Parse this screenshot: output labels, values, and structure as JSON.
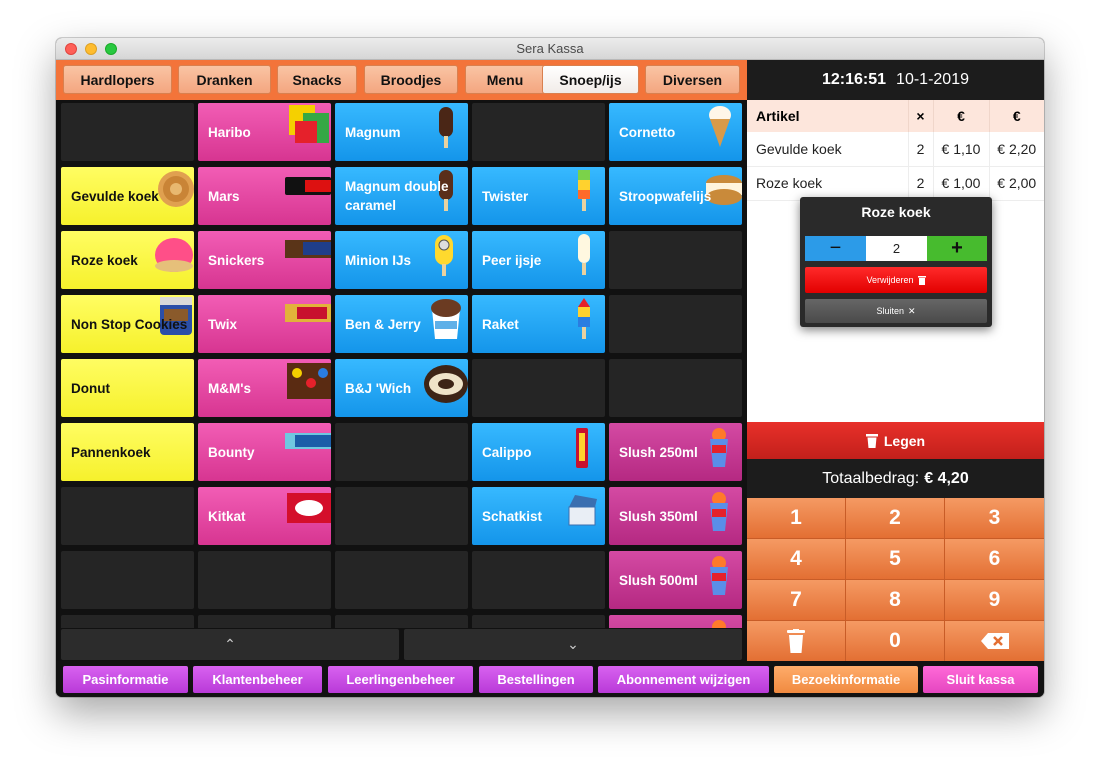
{
  "window": {
    "title": "Sera Kassa"
  },
  "categories": [
    {
      "label": "Hardlopers",
      "active": false
    },
    {
      "label": "Dranken",
      "active": false
    },
    {
      "label": "Snacks",
      "active": false
    },
    {
      "label": "Broodjes",
      "active": false
    },
    {
      "label": "Menu",
      "active": false
    },
    {
      "label": "Snoep/ijs",
      "active": true
    },
    {
      "label": "Diversen",
      "active": false
    }
  ],
  "products": {
    "gevulde_koek": "Gevulde koek",
    "roze_koek": "Roze koek",
    "non_stop_cookies": "Non Stop Cookies",
    "donut": "Donut",
    "pannenkoek": "Pannenkoek",
    "haribo": "Haribo",
    "mars": "Mars",
    "snickers": "Snickers",
    "twix": "Twix",
    "mms": "M&M's",
    "bounty": "Bounty",
    "kitkat": "Kitkat",
    "magnum": "Magnum",
    "magnum_double": "Magnum double caramel",
    "minion_ijs": "Minion IJs",
    "ben_jerry": "Ben & Jerry",
    "bj_wich": "B&J 'Wich",
    "twister": "Twister",
    "peer_ijsje": "Peer ijsje",
    "raket": "Raket",
    "calippo": "Calippo",
    "schatkist": "Schatkist",
    "cornetto": "Cornetto",
    "stroopwafelijs": "Stroopwafelijs",
    "slush_250": "Slush 250ml",
    "slush_350": "Slush 350ml",
    "slush_500": "Slush 500ml"
  },
  "scroll": {
    "up_icon": "chevron-up-icon",
    "down_icon": "chevron-down-icon",
    "up": "⌃",
    "down": "⌄"
  },
  "clock": {
    "time": "12:16:51",
    "date": "10-1-2019"
  },
  "order": {
    "headers": [
      "Artikel",
      "×",
      "€",
      "€"
    ],
    "rows": [
      {
        "artikel": "Gevulde koek",
        "qty": "2",
        "price": "€ 1,10",
        "total": "€ 2,20"
      },
      {
        "artikel": "Roze koek",
        "qty": "2",
        "price": "€ 1,00",
        "total": "€ 2,00"
      }
    ]
  },
  "popup": {
    "title": "Roze koek",
    "minus": "−",
    "quantity": "2",
    "plus": "+",
    "remove_label": "Verwijderen",
    "close_label": "Sluiten",
    "close_glyph": "✕"
  },
  "legen_label": "Legen",
  "total": {
    "label": "Totaalbedrag:",
    "amount": "€ 4,20"
  },
  "keypad": [
    "1",
    "2",
    "3",
    "4",
    "5",
    "6",
    "7",
    "8",
    "9",
    "trash-icon",
    "0",
    "backspace-icon"
  ],
  "keypad_labels": {
    "k1": "1",
    "k2": "2",
    "k3": "3",
    "k4": "4",
    "k5": "5",
    "k6": "6",
    "k7": "7",
    "k8": "8",
    "k9": "9",
    "k0": "0"
  },
  "bottom_bar": [
    "Pasinformatie",
    "Klantenbeheer",
    "Leerlingenbeheer",
    "Bestellingen",
    "Abonnement wijzigen",
    "Bezoekinformatie",
    "Sluit kassa"
  ],
  "colors": {
    "accent_orange": "#f3743a",
    "tile_yellow": "#f6f12c",
    "tile_pink": "#d73591",
    "tile_blue": "#1495ea",
    "tile_magenta": "#b52982",
    "danger_red": "#e20000",
    "button_purple": "#b93ad8"
  }
}
